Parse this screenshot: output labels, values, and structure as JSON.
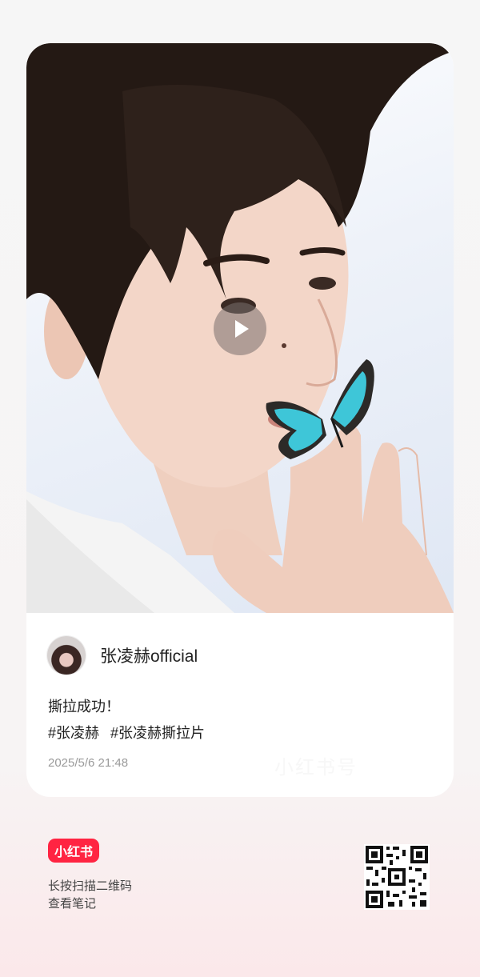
{
  "post": {
    "author_name": "张凌赫official",
    "text": "撕拉成功！",
    "tags": [
      "#张凌赫",
      "#张凌赫撕拉片"
    ],
    "date": "2025/5/6 21:48",
    "watermark": "小红书号"
  },
  "footer": {
    "brand_label": "小红书",
    "scan_hint_line1": "长按扫描二维码",
    "scan_hint_line2": "查看笔记"
  },
  "colors": {
    "brand": "#ff2442",
    "butterfly": "#3ec6d8"
  },
  "icons": {
    "play": "play-icon",
    "qr": "qr-code-icon"
  }
}
